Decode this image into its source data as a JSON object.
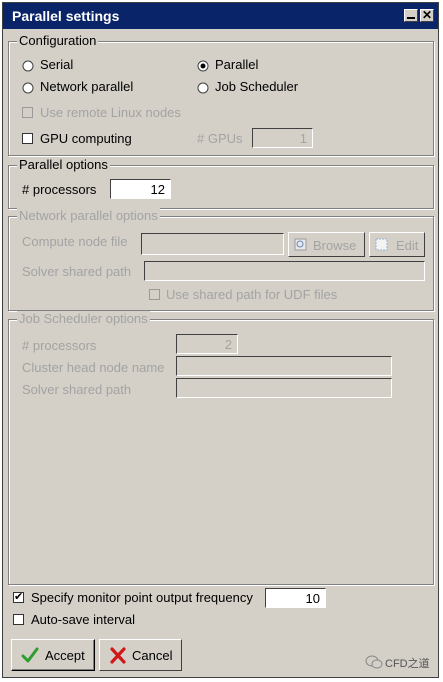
{
  "window": {
    "title": "Parallel settings",
    "close_glyph": "✕"
  },
  "configuration": {
    "legend": "Configuration",
    "serial": "Serial",
    "parallel": "Parallel",
    "network_parallel": "Network parallel",
    "job_scheduler": "Job Scheduler",
    "selected": "Parallel",
    "remote_linux": "Use remote Linux nodes",
    "gpu_computing": "GPU computing",
    "gpus_label": "# GPUs",
    "gpus_value": "1"
  },
  "parallel_options": {
    "legend": "Parallel options",
    "processors_label": "# processors",
    "processors_value": "12"
  },
  "network_parallel_options": {
    "legend": "Network parallel options",
    "compute_node_file_label": "Compute node file",
    "browse_label": "Browse",
    "edit_label": "Edit",
    "solver_shared_path_label": "Solver shared path",
    "use_shared_path_label": "Use shared path for UDF files"
  },
  "job_scheduler_options": {
    "legend": "Job Scheduler options",
    "processors_label": "# processors",
    "processors_value": "2",
    "cluster_head_node_label": "Cluster head node name",
    "solver_shared_path_label": "Solver shared path"
  },
  "monitor": {
    "specify_label": "Specify monitor point output frequency",
    "specify_checked": true,
    "frequency_value": "10",
    "autosave_label": "Auto-save interval",
    "autosave_checked": false
  },
  "buttons": {
    "accept": "Accept",
    "cancel": "Cancel"
  },
  "watermark": {
    "text": "CFD之道"
  },
  "colors": {
    "title_bg": "#0a246a",
    "dialog_bg": "#d4d0c8",
    "disabled_text": "#a3a3a3",
    "accept_green": "#2e9e2e",
    "cancel_red": "#d01818"
  }
}
